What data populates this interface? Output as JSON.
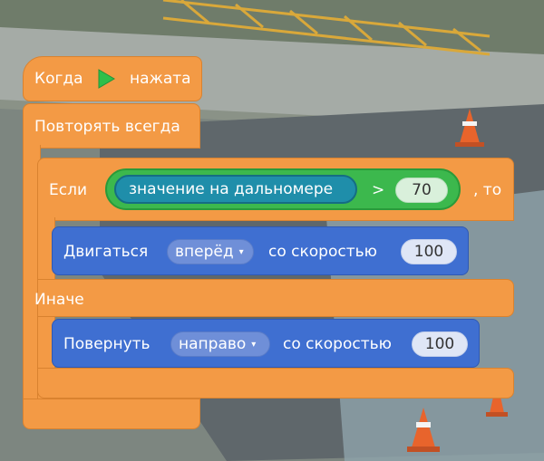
{
  "colors": {
    "control": "#f39a45",
    "motion": "#3f6fd1",
    "operator": "#3cb84d",
    "sensor": "#1f8eaa",
    "flag": "#2fbf4a"
  },
  "script": {
    "hat": {
      "label_when": "Когда",
      "flag_icon": "green-flag-icon",
      "label_clicked": "нажата"
    },
    "forever": {
      "label": "Повторять всегда"
    },
    "if_block": {
      "label_if": "Если",
      "label_then": ", то"
    },
    "condition": {
      "sensor_label": "значение на дальномере",
      "operator": ">",
      "value": "70"
    },
    "move": {
      "label": "Двигаться",
      "direction": "вперёд",
      "speed_label": "со скоростью",
      "speed": "100"
    },
    "else_label": "Иначе",
    "turn": {
      "label": "Повернуть",
      "direction": "направо",
      "speed_label": "со скоростью",
      "speed": "100"
    },
    "dropdown_icon": "chevron-down-icon"
  }
}
